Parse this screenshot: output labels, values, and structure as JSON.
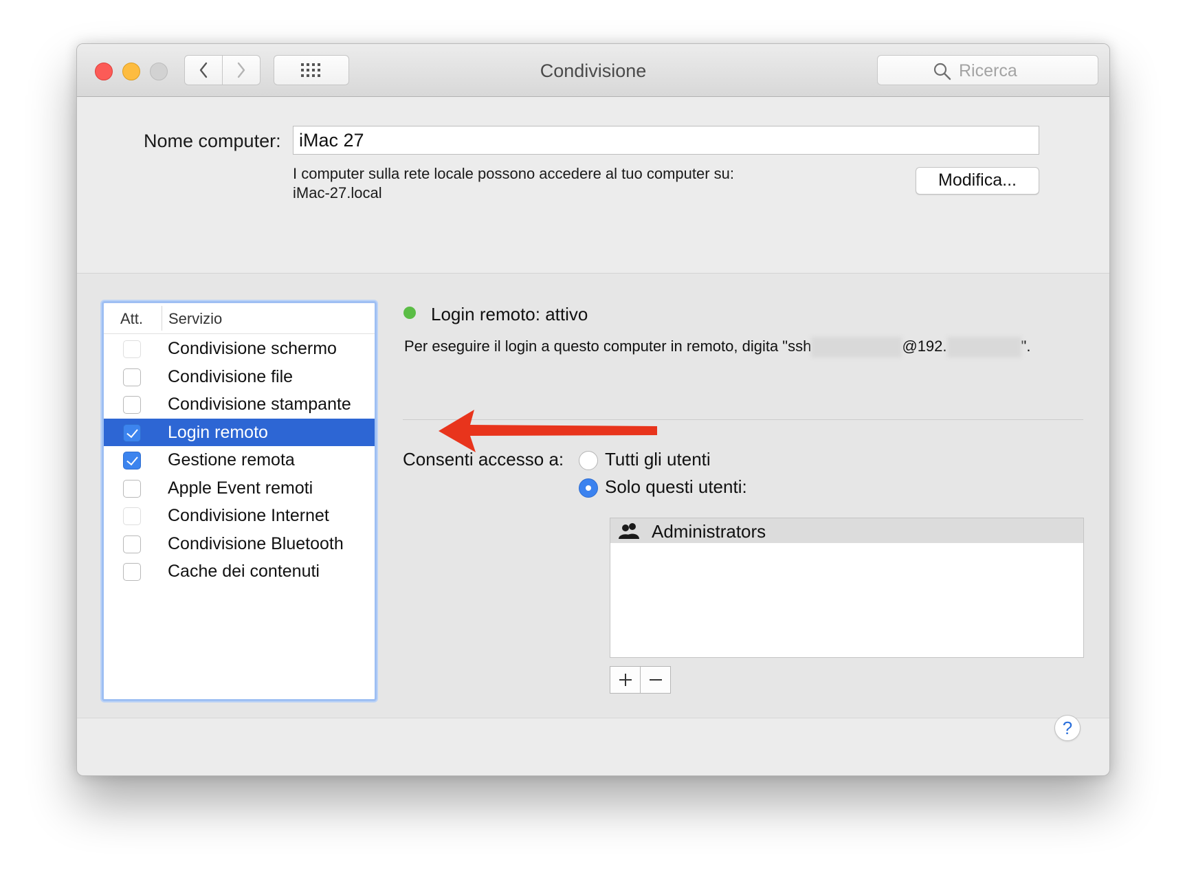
{
  "window": {
    "title": "Condivisione"
  },
  "toolbar": {
    "search_placeholder": "Ricerca"
  },
  "computer_name": {
    "label": "Nome computer:",
    "value": "iMac 27",
    "description_line1": "I computer sulla rete locale possono accedere al tuo computer su:",
    "description_line2": "iMac-27.local",
    "edit_button": "Modifica..."
  },
  "services": {
    "header_att": "Att.",
    "header_service": "Servizio",
    "items": [
      {
        "label": "Condivisione schermo",
        "checked": false,
        "enabled": false
      },
      {
        "label": "Condivisione file",
        "checked": false,
        "enabled": true
      },
      {
        "label": "Condivisione stampante",
        "checked": false,
        "enabled": true
      },
      {
        "label": "Login remoto",
        "checked": true,
        "enabled": true,
        "selected": true
      },
      {
        "label": "Gestione remota",
        "checked": true,
        "enabled": true
      },
      {
        "label": "Apple Event remoti",
        "checked": false,
        "enabled": true
      },
      {
        "label": "Condivisione Internet",
        "checked": false,
        "enabled": false
      },
      {
        "label": "Condivisione Bluetooth",
        "checked": false,
        "enabled": true
      },
      {
        "label": "Cache dei contenuti",
        "checked": false,
        "enabled": true
      }
    ]
  },
  "detail": {
    "status_text": "Login remoto: attivo",
    "status_color": "#5bbd46",
    "ssh_prefix": "Per eseguire il login a questo computer in remoto, digita \"ssh",
    "ssh_at": "@192.",
    "ssh_suffix": "\".",
    "access_label": "Consenti accesso a:",
    "option_all": "Tutti gli utenti",
    "option_only": "Solo questi utenti:",
    "selected_option": "only",
    "users": [
      "Administrators"
    ]
  },
  "colors": {
    "selection": "#2d66d4",
    "accent": "#3b82ef",
    "annotation_arrow": "#e8341c"
  }
}
